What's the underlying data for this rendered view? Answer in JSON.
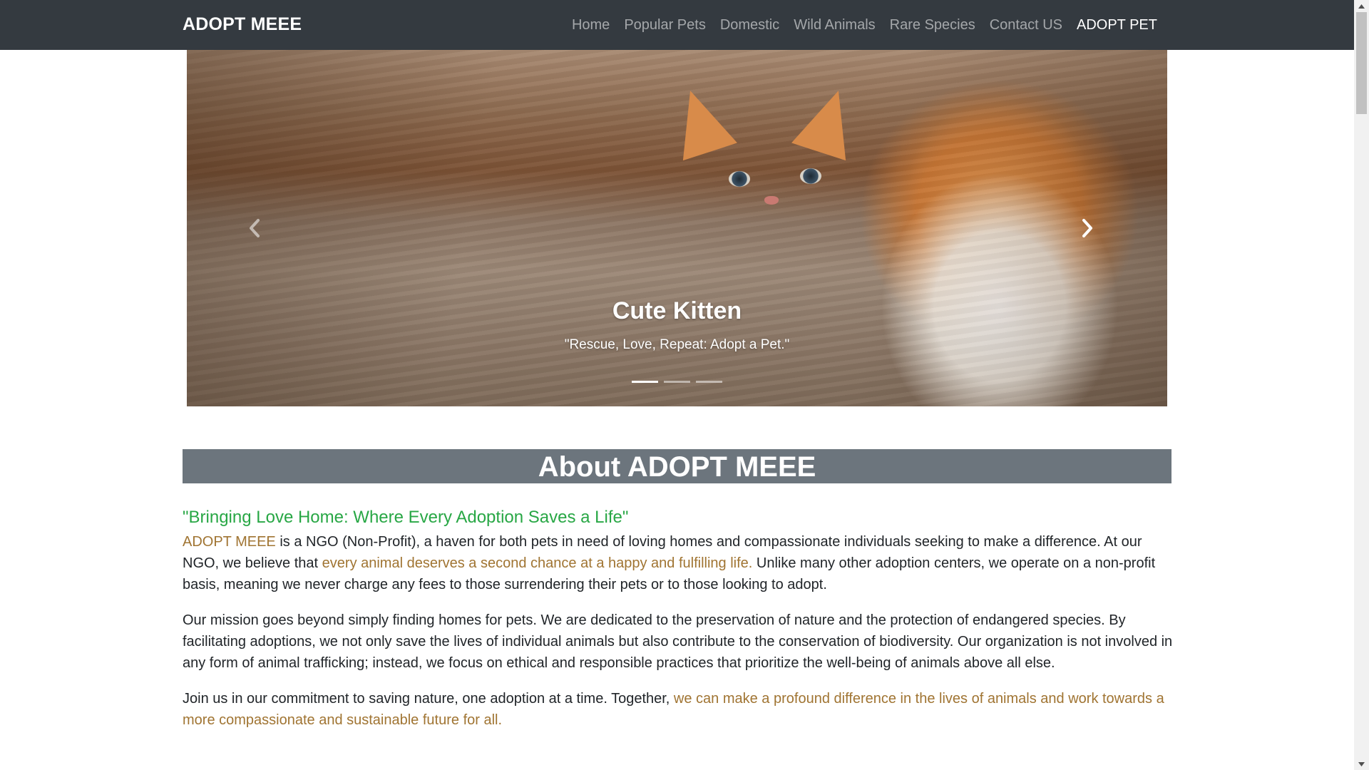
{
  "navbar": {
    "brand": "ADOPT MEEE",
    "links": [
      {
        "label": "Home"
      },
      {
        "label": "Popular Pets"
      },
      {
        "label": "Domestic"
      },
      {
        "label": "Wild Animals"
      },
      {
        "label": "Rare Species"
      },
      {
        "label": "Contact US"
      },
      {
        "label": "ADOPT PET"
      }
    ],
    "active_index": 6
  },
  "carousel": {
    "caption_title": "Cute Kitten",
    "caption_text": "\"Rescue, Love, Repeat: Adopt a Pet.\"",
    "slide_count": 3,
    "active_slide": 1,
    "prev_icon": "chevron-left-icon",
    "next_icon": "chevron-right-icon"
  },
  "about": {
    "heading": "About ADOPT MEEE",
    "tagline": "\"Bringing Love Home: Where Every Adoption Saves a Life\"",
    "p1": {
      "hl1": "ADOPT MEEE",
      "t1": " is a NGO (Non-Profit), a haven for both pets in need of loving homes and compassionate individuals seeking to make a difference. At our NGO, we believe that ",
      "hl2": "every animal deserves a second chance at a happy and fulfilling life.",
      "t2": " Unlike many other adoption centers, we operate on a non-profit basis, meaning we never charge any fees to those surrendering their pets or to those looking to adopt."
    },
    "p2": "Our mission goes beyond simply finding homes for pets. We are dedicated to the preservation of nature and the protection of endangered species. By facilitating adoptions, we not only save the lives of individual animals but also contribute to the conservation of biodiversity. Our organization is not involved in any form of animal trafficking; instead, we focus on ethical and responsible practices that prioritize the well-being of animals above all else.",
    "p3": {
      "t1": "Join us in our commitment to saving nature, one adoption at a time. Together, ",
      "hl1": "we can make a profound difference in the lives of animals and work towards a more compassionate and sustainable future for all."
    }
  },
  "colors": {
    "navbar_bg": "#343a40",
    "header_bg": "#6c757d",
    "tagline": "#28a745",
    "highlight": "#a07432"
  }
}
